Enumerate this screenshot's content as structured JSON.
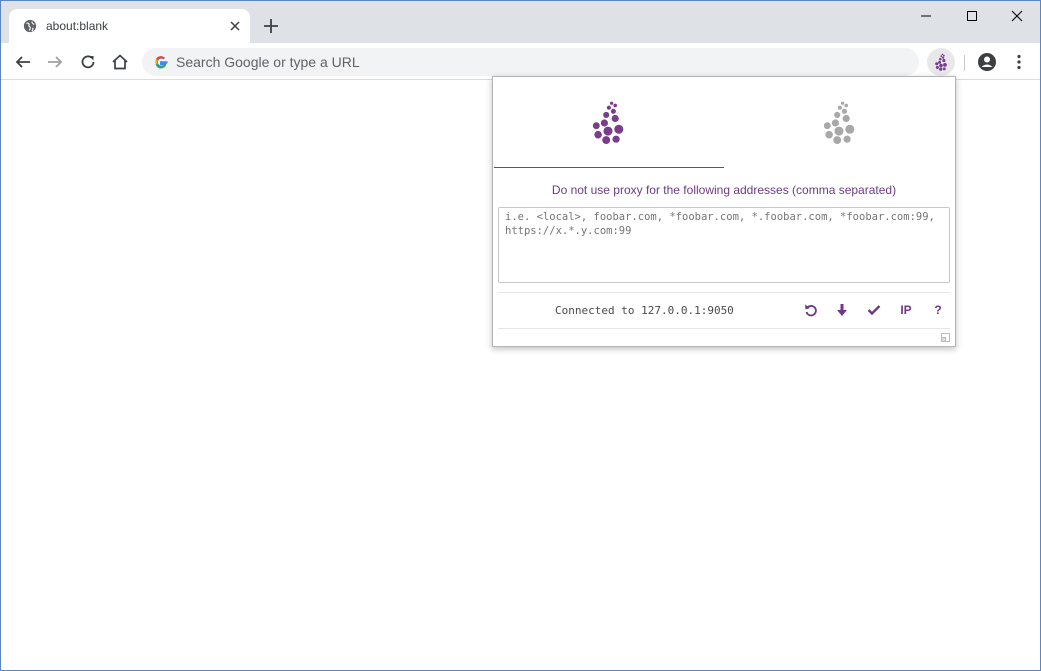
{
  "tab": {
    "title": "about:blank",
    "favicon": "globe-icon"
  },
  "omnibox": {
    "placeholder": "Search Google or type a URL"
  },
  "popup": {
    "info": "Do not use proxy for the following addresses (comma separated)",
    "bypass_placeholder": "i.e. <local>, foobar.com, *foobar.com, *.foobar.com, *foobar.com:99, https://x.*.y.com:99",
    "status": "Connected to 127.0.0.1:9050",
    "actions": {
      "ip_label": "IP",
      "help_label": "?"
    }
  },
  "colors": {
    "accent": "#7a3d8c",
    "inactive": "#a8a8a8",
    "tabstrip": "#dee1e6"
  }
}
